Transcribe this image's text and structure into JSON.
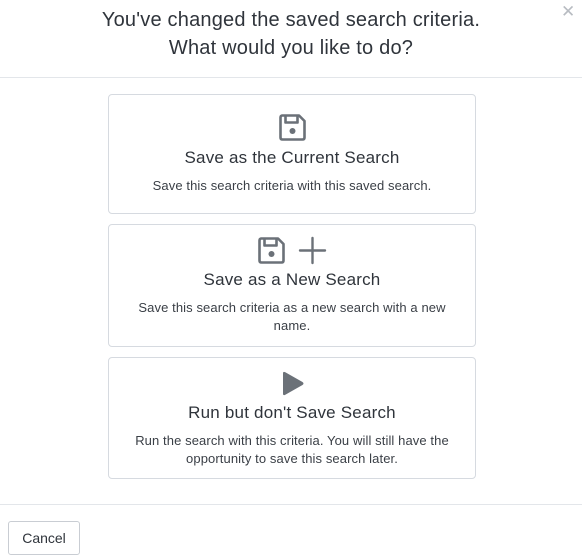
{
  "dialog": {
    "title_line1": "You've changed the saved search criteria.",
    "title_line2": "What would you like to do?",
    "close_icon": "close-icon"
  },
  "options": [
    {
      "icons": [
        "floppy-disk-icon"
      ],
      "title": "Save as the Current Search",
      "description": "Save this search criteria with this saved search."
    },
    {
      "icons": [
        "floppy-disk-icon",
        "plus-icon"
      ],
      "title": "Save as a New Search",
      "description": "Save this search criteria as a new search with a new name."
    },
    {
      "icons": [
        "play-icon"
      ],
      "title": "Run but don't Save Search",
      "description": "Run the search with this criteria. You will still have the opportunity to save this search later."
    }
  ],
  "footer": {
    "cancel_label": "Cancel"
  },
  "colors": {
    "icon": "#6b7178",
    "border": "#d6dae0",
    "text": "#2f343b"
  }
}
